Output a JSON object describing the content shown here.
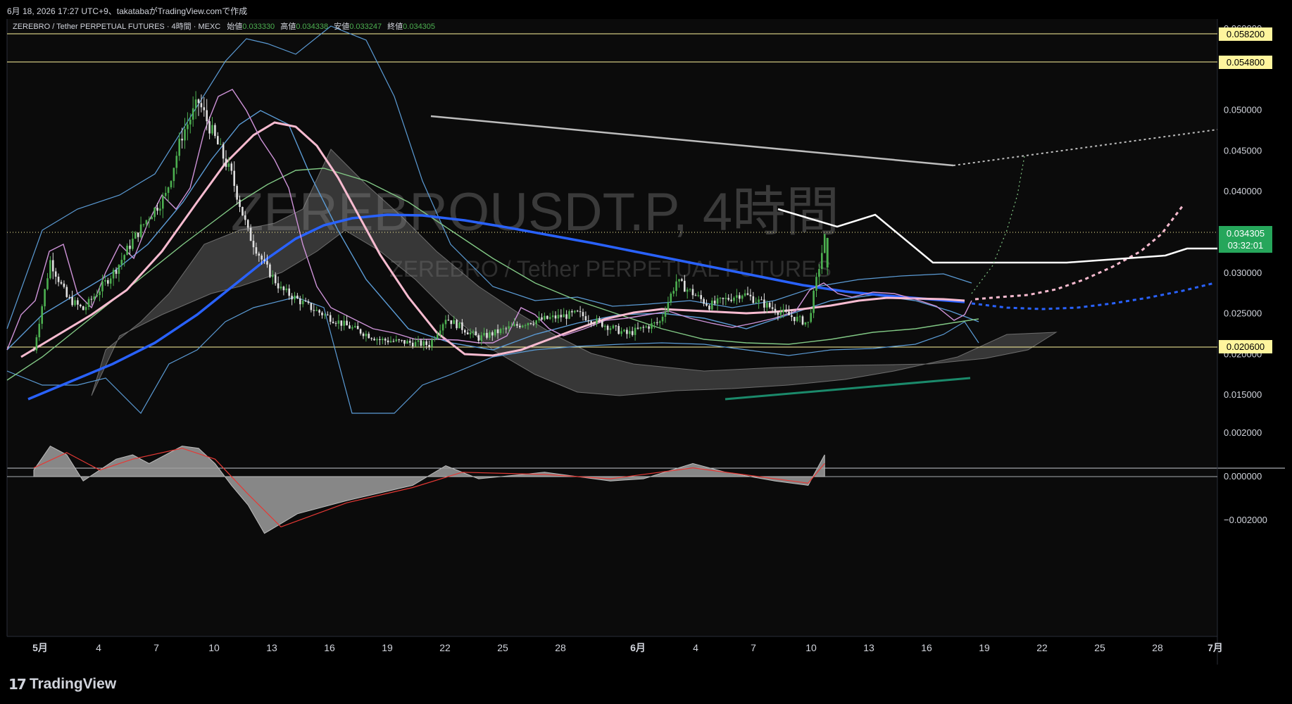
{
  "header": {
    "caption": "6月 18, 2026 17:27 UTC+9、takatabaがTradingView.comで作成"
  },
  "legend": {
    "symbol": "ZEREBRO / Tether PERPETUAL FUTURES · 4時間 · MEXC",
    "open_label": "始値",
    "open": "0.033330",
    "high_label": "高値",
    "high": "0.034338",
    "low_label": "安値",
    "low": "0.033247",
    "close_label": "終値",
    "close": "0.034305"
  },
  "watermark": {
    "line1": "ZEREBROUSDT.P, 4時間",
    "line2": "ZEREBRO / Tether PERPETUAL FUTURES"
  },
  "price_axis": {
    "ticks": [
      "0.060000",
      "0.050000",
      "0.045000",
      "0.040000",
      "0.035000",
      "0.030000",
      "0.025000",
      "0.020000",
      "0.015000"
    ],
    "level_labels": [
      "0.058200",
      "0.054800",
      "0.020600"
    ],
    "current_price": "0.034305",
    "countdown": "03:32:01"
  },
  "osc_axis": {
    "ticks": [
      "0.002000",
      "0.000000",
      "−0.002000"
    ]
  },
  "time_axis": {
    "ticks": [
      "5月",
      "4",
      "7",
      "10",
      "13",
      "16",
      "19",
      "22",
      "25",
      "28",
      "6月",
      "4",
      "7",
      "10",
      "13",
      "16",
      "19",
      "22",
      "25",
      "28",
      "7月"
    ]
  },
  "footer": {
    "brand": "TradingView"
  },
  "colors": {
    "up": "#4caf50",
    "down": "#e0e0e0",
    "ma_fast": "#f8bbd0",
    "ma_slow": "#2962ff",
    "ma_mid": "#81c784",
    "bollinger": "#5b9bd5",
    "level": "#fff59d",
    "macd_signal": "#e53935",
    "current_badge": "#26a65b"
  },
  "chart_data": [
    {
      "type": "candlestick",
      "title": "ZEREBROUSDT.P, 4時間",
      "timeframe": "4時間",
      "exchange": "MEXC",
      "ylim": [
        0.0145,
        0.0612
      ],
      "horizontal_levels": [
        0.0582,
        0.0548,
        0.0206
      ],
      "last": {
        "open": 0.03333,
        "high": 0.034338,
        "low": 0.033247,
        "close": 0.034305
      },
      "price_path": [
        [
          "5月 1",
          0.0205
        ],
        [
          "5月 2",
          0.0315
        ],
        [
          "5月 3",
          0.027
        ],
        [
          "5月 4",
          0.0255
        ],
        [
          "5月 6",
          0.0305
        ],
        [
          "5月 7",
          0.034
        ],
        [
          "5月 8",
          0.037
        ],
        [
          "5月 9",
          0.0395
        ],
        [
          "5月 10",
          0.047
        ],
        [
          "5月 11",
          0.051
        ],
        [
          "5月 12",
          0.0465
        ],
        [
          "5月 13",
          0.042
        ],
        [
          "5月 14",
          0.035
        ],
        [
          "5月 15",
          0.031
        ],
        [
          "5月 16",
          0.028
        ],
        [
          "5月 18",
          0.0255
        ],
        [
          "5月 20",
          0.0235
        ],
        [
          "5月 22",
          0.0218
        ],
        [
          "5月 25",
          0.0212
        ],
        [
          "5月 26",
          0.0245
        ],
        [
          "5月 28",
          0.022
        ],
        [
          "5月 31",
          0.024
        ],
        [
          "6月 3",
          0.025
        ],
        [
          "6月 6",
          0.0225
        ],
        [
          "6月 8",
          0.024
        ],
        [
          "6月 9",
          0.029
        ],
        [
          "6月 11",
          0.026
        ],
        [
          "6月 13",
          0.0275
        ],
        [
          "6月 15",
          0.0255
        ],
        [
          "6月 17",
          0.0238
        ],
        [
          "6月 18",
          0.0343
        ]
      ]
    },
    {
      "type": "area",
      "panel": "oscillator",
      "ylim": [
        -0.0029,
        0.0029
      ],
      "series": [
        {
          "values": [
            [
              "5月 1",
              0.0003
            ],
            [
              "5月 2",
              0.0014
            ],
            [
              "5月 3",
              0.001
            ],
            [
              "5月 4",
              -0.0002
            ],
            [
              "5月 6",
              0.0008
            ],
            [
              "5月 7",
              0.001
            ],
            [
              "5月 8",
              0.0006
            ],
            [
              "5月 10",
              0.0014
            ],
            [
              "5月 11",
              0.0013
            ],
            [
              "5月 12",
              0.0006
            ],
            [
              "5月 13",
              -0.0004
            ],
            [
              "5月 14",
              -0.0013
            ],
            [
              "5月 15",
              -0.0026
            ],
            [
              "5月 17",
              -0.0017
            ],
            [
              "5月 20",
              -0.0011
            ],
            [
              "5月 24",
              -0.0004
            ],
            [
              "5月 26",
              0.0005
            ],
            [
              "5月 28",
              -0.0001
            ],
            [
              "6月 1",
              0.0002
            ],
            [
              "6月 5",
              -0.0002
            ],
            [
              "6月 7",
              -0.0001
            ],
            [
              "6月 10",
              0.0006
            ],
            [
              "6月 12",
              0.0002
            ],
            [
              "6月 15",
              -0.0002
            ],
            [
              "6月 17",
              -0.0004
            ],
            [
              "6月 18",
              0.001
            ]
          ]
        },
        {
          "values": [
            [
              "5月 1",
              0.0004
            ],
            [
              "5月 3",
              0.0011
            ],
            [
              "5月 5",
              0.0003
            ],
            [
              "5月 7",
              0.0008
            ],
            [
              "5月 10",
              0.0013
            ],
            [
              "5月 12",
              0.0008
            ],
            [
              "5月 14",
              -0.0008
            ],
            [
              "5月 16",
              -0.0023
            ],
            [
              "5月 20",
              -0.0012
            ],
            [
              "5月 24",
              -0.0005
            ],
            [
              "5月 27",
              0.0002
            ],
            [
              "6月 1",
              0.0001
            ],
            [
              "6月 5",
              -0.0001
            ],
            [
              "6月 10",
              0.0004
            ],
            [
              "6月 13",
              0.0001
            ],
            [
              "6月 17",
              -0.0003
            ],
            [
              "6月 18",
              0.0006
            ]
          ]
        }
      ]
    }
  ]
}
